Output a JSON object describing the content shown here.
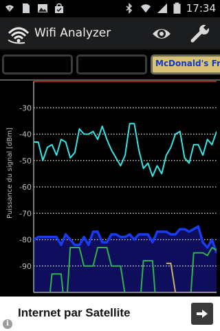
{
  "status_bar": {
    "time": "17:34",
    "left_icons": [
      "wifi-question-icon",
      "file-icon",
      "image-icon",
      "shopping-bag-icon"
    ],
    "right_icons": [
      "bluetooth-icon",
      "wifi-icon",
      "signal-icon",
      "battery-icon"
    ]
  },
  "action_bar": {
    "title": "Wifi Analyzer",
    "icons": [
      "app-logo-icon",
      "eye-icon",
      "wrench-icon"
    ]
  },
  "filters": {
    "items": [
      {
        "label": "",
        "selected": false
      },
      {
        "label": "",
        "selected": false
      },
      {
        "label": "McDonald's Fr",
        "selected": true
      }
    ]
  },
  "chart": {
    "ylabel": "Puissance du signal [dBm]",
    "ytick_labels": [
      "-30",
      "-40",
      "-50",
      "-60",
      "-70",
      "-80",
      "-90"
    ]
  },
  "chart_data": {
    "type": "line",
    "ylabel": "Puissance du signal [dBm]",
    "ylim": [
      -100,
      -20
    ],
    "grid": true,
    "yticks": [
      -30,
      -40,
      -50,
      -60,
      -70,
      -80,
      -90
    ],
    "x": [
      0,
      1,
      2,
      3,
      4,
      5,
      6,
      7,
      8,
      9,
      10,
      11,
      12,
      13,
      14,
      15,
      16,
      17,
      18,
      19,
      20,
      21,
      22,
      23,
      24,
      25,
      26,
      27,
      28,
      29,
      30,
      31,
      32,
      33,
      34,
      35,
      36,
      37,
      38,
      39,
      40
    ],
    "series": [
      {
        "color": "#34e6e6",
        "values": [
          -43,
          -43,
          -50,
          -45,
          -44,
          -48,
          -42,
          -43,
          -49,
          -47,
          -38,
          -40,
          -40,
          -39,
          -42,
          -37,
          -42,
          -46,
          -49,
          -52,
          -48,
          -36,
          -36,
          -46,
          -53,
          -51,
          -56,
          -52,
          -55,
          -48,
          -45,
          -40,
          -39,
          -49,
          -51,
          -44,
          -44,
          -48,
          -42,
          -44,
          -39
        ]
      },
      {
        "color": "#1a3cf0",
        "fill": "#0e0e5c",
        "values": [
          -80,
          -79,
          -79,
          -79,
          -79,
          -79,
          -82,
          -78,
          -80,
          -82,
          -82,
          -79,
          -82,
          -77,
          -77,
          -81,
          -81,
          -78,
          -78,
          -79,
          -79,
          -78,
          -80,
          -78,
          -78,
          -78,
          -81,
          -77,
          -77,
          -77,
          -78,
          -78,
          -76,
          -76,
          -77,
          -76,
          -75,
          -81,
          -83,
          -80,
          -85
        ]
      },
      {
        "color": "#2db54a",
        "values": [
          -110,
          -110,
          -110,
          -110,
          -93,
          -93,
          -93,
          -110,
          -83,
          -83,
          -83,
          -90,
          -90,
          -90,
          -83,
          -83,
          -83,
          -90,
          -90,
          -90,
          -101,
          -101,
          -110,
          -110,
          -88,
          -88,
          -88,
          -110,
          -110,
          -110,
          -110,
          -110,
          -110,
          -110,
          -110,
          -85,
          -85,
          -85,
          -86,
          -83,
          -84
        ]
      },
      {
        "color": "#c9b26a",
        "values": [
          null,
          null,
          null,
          null,
          null,
          null,
          null,
          null,
          null,
          null,
          null,
          null,
          null,
          null,
          null,
          null,
          null,
          null,
          null,
          null,
          null,
          null,
          null,
          null,
          null,
          null,
          null,
          null,
          null,
          -89,
          -89,
          -100,
          -100,
          -100,
          -100,
          -100,
          -100,
          -100,
          -100,
          -100,
          -100
        ]
      }
    ]
  },
  "ad": {
    "text": "Internet par Satellite",
    "info_glyph": "i"
  }
}
